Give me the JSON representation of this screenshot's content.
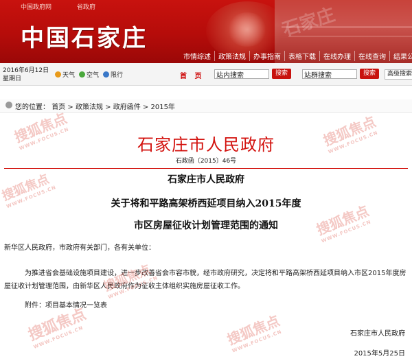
{
  "header": {
    "top_links": [
      "中国政府网",
      "省政府"
    ],
    "site_title": "中国石家庄",
    "nav": [
      "市情综述",
      "政策法规",
      "办事指南",
      "表格下载",
      "在线办理",
      "在线查询",
      "结果公"
    ]
  },
  "utility": {
    "date_line1": "2016年6月12日",
    "date_line2": "星期日",
    "weather": [
      {
        "label": "天气",
        "icon": "sun-icon",
        "color": "#e89a1a"
      },
      {
        "label": "空气",
        "icon": "air-icon",
        "color": "#4aa83c"
      },
      {
        "label": "限行",
        "icon": "car-icon",
        "color": "#3a78c8"
      }
    ],
    "home_label": "首 页",
    "site_search_value": "站内搜索",
    "site_search_button": "搜索",
    "group_search_value": "站群搜索",
    "group_search_button": "搜索",
    "advanced_search": "高级搜索"
  },
  "breadcrumb": {
    "prefix": "您的位置：",
    "items": [
      "首页",
      "政策法规",
      "政府函件",
      "2015年"
    ]
  },
  "document": {
    "issuer_heading": "石家庄市人民政府",
    "doc_number": "石政函〔2015〕46号",
    "addressee_title": "石家庄市人民政府",
    "title_line1": "关于将和平路高架桥西延项目纳入2015年度",
    "title_line2": "市区房屋征收计划管理范围的通知",
    "salutation": "新华区人民政府，市政府有关部门，各有关单位：",
    "body": "为推进省会基础设施项目建设，进一步改善省会市容市貌，经市政府研究，决定将和平路高架桥西延项目纳入市区2015年度房屋征收计划管理范围，由新华区人民政府作为征收主体组织实施房屋征收工作。",
    "attachment": "附件：项目基本情况一览表",
    "signature": "石家庄市人民政府",
    "date": "2015年5月25日"
  },
  "watermark": {
    "brand": "搜狐",
    "tag": "焦点",
    "url": "WWW.FOCUS.CN",
    "banner_text": "石家庄"
  },
  "colors": {
    "banner_red": "#c8120e",
    "heading_red": "#d3130f"
  }
}
